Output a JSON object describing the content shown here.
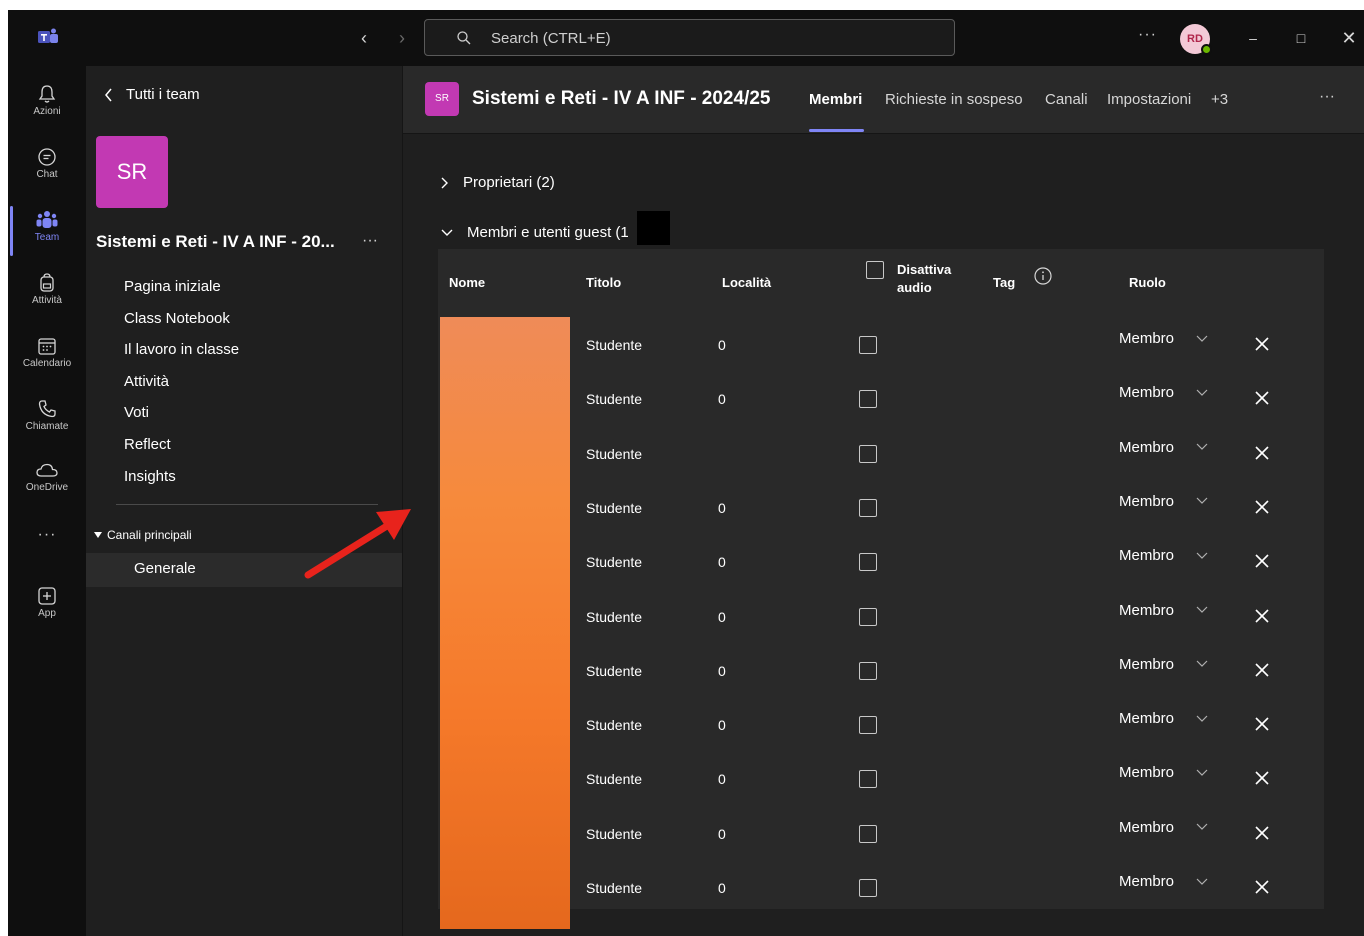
{
  "app": {
    "search_placeholder": "Search (CTRL+E)",
    "more_label": "···",
    "user_initials": "RD",
    "accent_color": "#7f85f5",
    "team_color": "#c239b3"
  },
  "rail": {
    "items": [
      {
        "label": "Azioni",
        "icon": "bell-icon"
      },
      {
        "label": "Chat",
        "icon": "chat-icon"
      },
      {
        "label": "Team",
        "icon": "teams-icon",
        "active": true
      },
      {
        "label": "Attività",
        "icon": "backpack-icon"
      },
      {
        "label": "Calendario",
        "icon": "calendar-icon"
      },
      {
        "label": "Chiamate",
        "icon": "phone-icon"
      },
      {
        "label": "OneDrive",
        "icon": "cloud-icon"
      }
    ],
    "more_label": "···",
    "apps_label": "App"
  },
  "team_panel": {
    "back_label": "Tutti i team",
    "tile_initials": "SR",
    "team_name": "Sistemi e Reti - IV A INF - 20...",
    "more_label": "···",
    "nav": [
      "Pagina iniziale",
      "Class Notebook",
      "Il lavoro in classe",
      "Attività",
      "Voti",
      "Reflect",
      "Insights"
    ],
    "channels_header": "Canali principali",
    "channel": "Generale"
  },
  "main": {
    "tile_initials": "SR",
    "title": "Sistemi e Reti - IV A INF - 2024/25",
    "tabs": [
      "Membri",
      "Richieste in sospeso",
      "Canali",
      "Impostazioni",
      "+3"
    ],
    "more_label": "···",
    "owners_section": "Proprietari (2)",
    "members_section": "Membri e utenti guest (1",
    "columns": {
      "name": "Nome",
      "title": "Titolo",
      "location": "Località",
      "mute": "Disattiva audio",
      "tag": "Tag",
      "role": "Ruolo"
    },
    "rows": [
      {
        "title": "Studente",
        "location": "0",
        "role": "Membro"
      },
      {
        "title": "Studente",
        "location": "0",
        "role": "Membro"
      },
      {
        "title": "Studente",
        "location": "",
        "role": "Membro"
      },
      {
        "title": "Studente",
        "location": "0",
        "role": "Membro"
      },
      {
        "title": "Studente",
        "location": "0",
        "role": "Membro"
      },
      {
        "title": "Studente",
        "location": "0",
        "role": "Membro"
      },
      {
        "title": "Studente",
        "location": "0",
        "role": "Membro"
      },
      {
        "title": "Studente",
        "location": "0",
        "role": "Membro"
      },
      {
        "title": "Studente",
        "location": "0",
        "role": "Membro"
      },
      {
        "title": "Studente",
        "location": "0",
        "role": "Membro"
      },
      {
        "title": "Studente",
        "location": "0",
        "role": "Membro"
      }
    ]
  }
}
